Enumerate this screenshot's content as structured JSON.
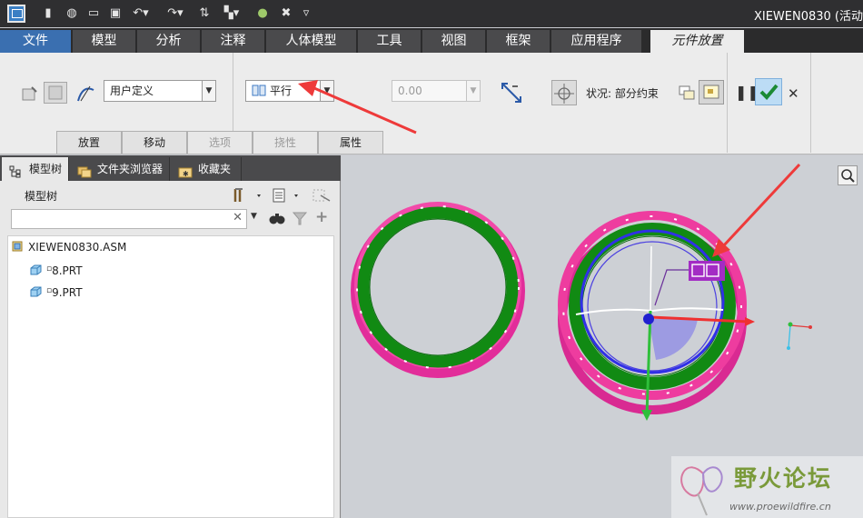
{
  "window": {
    "title": "XIEWEN0830 (活动"
  },
  "quick_access": [
    {
      "name": "new-icon",
      "glyph": "▮"
    },
    {
      "name": "open-icon",
      "glyph": "◍"
    },
    {
      "name": "folder-icon",
      "glyph": "▭"
    },
    {
      "name": "save-icon",
      "glyph": "▣"
    },
    {
      "name": "undo-icon",
      "glyph": "↶"
    },
    {
      "name": "redo-icon",
      "glyph": "↷"
    },
    {
      "name": "regenerate-icon",
      "glyph": "⇅"
    },
    {
      "name": "windows-icon",
      "glyph": "▚"
    },
    {
      "name": "render-icon",
      "glyph": "●"
    },
    {
      "name": "close-window-icon",
      "glyph": "✖"
    },
    {
      "name": "customize-icon",
      "glyph": "▿"
    }
  ],
  "tabs": [
    {
      "label": "文件"
    },
    {
      "label": "模型"
    },
    {
      "label": "分析"
    },
    {
      "label": "注释"
    },
    {
      "label": "人体模型"
    },
    {
      "label": "工具"
    },
    {
      "label": "视图"
    },
    {
      "label": "框架"
    },
    {
      "label": "应用程序"
    },
    {
      "label": "元件放置"
    }
  ],
  "ribbon": {
    "constraint_set": "用户定义",
    "constraint_type": "平行",
    "offset_value": "0.00",
    "status": "状况: 部分约束"
  },
  "subtabs": [
    {
      "label": "放置"
    },
    {
      "label": "移动"
    },
    {
      "label": "选项"
    },
    {
      "label": "挠性"
    },
    {
      "label": "属性"
    }
  ],
  "nav": {
    "tabs": [
      {
        "label": "模型树"
      },
      {
        "label": "文件夹浏览器"
      },
      {
        "label": "收藏夹"
      }
    ],
    "tree_header": "模型树",
    "search_placeholder": "",
    "clear_symbol": "✕",
    "tree": [
      {
        "label": "XIEWEN0830.ASM"
      },
      {
        "label": "8.PRT"
      },
      {
        "label": "9.PRT"
      }
    ]
  },
  "watermark": {
    "text": "野火论坛",
    "url": "www.proewildfire.cn"
  },
  "colors": {
    "ring_green": "#138a13",
    "ring_magenta": "#e82c9c",
    "circle_blue": "#2f3fe6",
    "arrow_red": "#ef3a3a",
    "accent_purple": "#a32cc4"
  }
}
